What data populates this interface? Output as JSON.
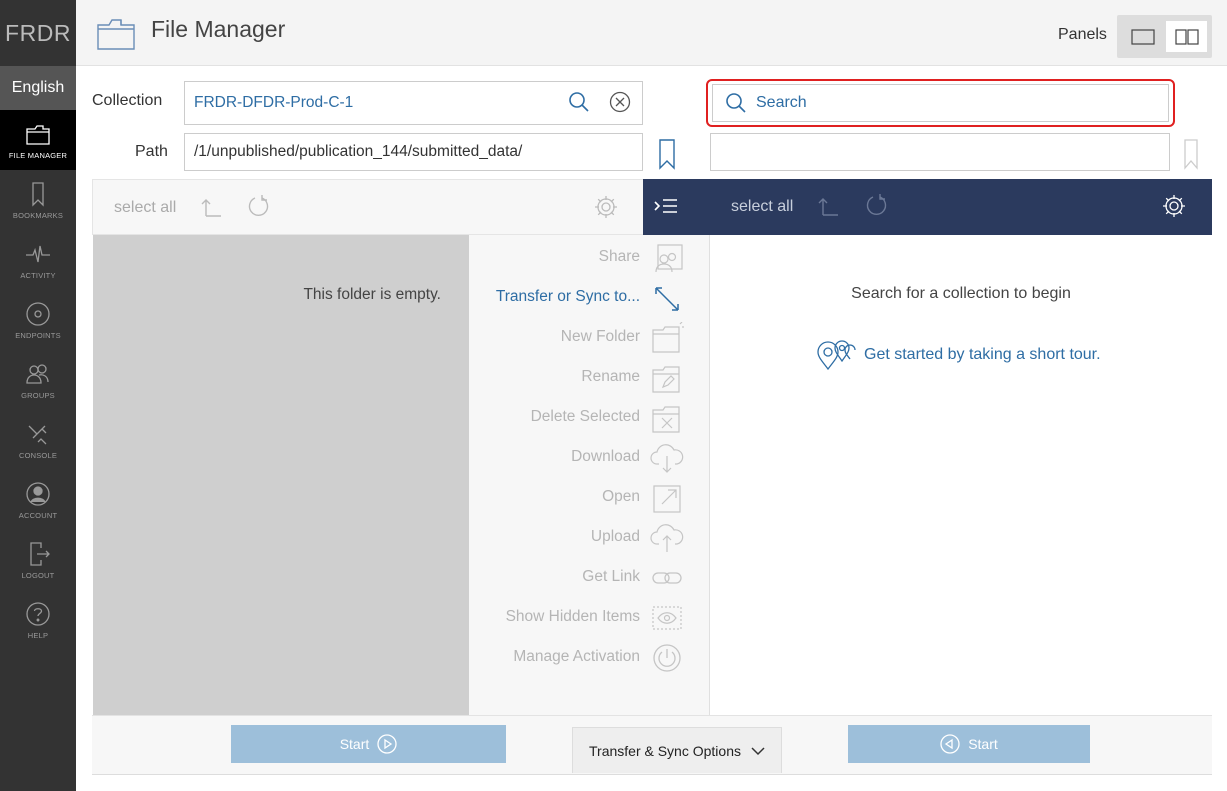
{
  "sidebar": {
    "brand": "FRDR",
    "language": "English",
    "items": [
      {
        "label": "FILE MANAGER",
        "icon": "folder-icon",
        "active": true
      },
      {
        "label": "BOOKMARKS",
        "icon": "bookmark-icon"
      },
      {
        "label": "ACTIVITY",
        "icon": "activity-icon"
      },
      {
        "label": "ENDPOINTS",
        "icon": "endpoints-icon"
      },
      {
        "label": "GROUPS",
        "icon": "groups-icon"
      },
      {
        "label": "CONSOLE",
        "icon": "console-icon"
      },
      {
        "label": "ACCOUNT",
        "icon": "account-icon"
      },
      {
        "label": "LOGOUT",
        "icon": "logout-icon"
      },
      {
        "label": "HELP",
        "icon": "help-icon"
      }
    ]
  },
  "header": {
    "title": "File Manager",
    "panels_label": "Panels"
  },
  "left": {
    "collection_label": "Collection",
    "collection_value": "FRDR-DFDR-Prod-C-1",
    "path_label": "Path",
    "path_value": "/1/unpublished/publication_144/submitted_data/",
    "select_all": "select all",
    "empty_message": "This folder is empty."
  },
  "right": {
    "search_placeholder": "Search",
    "path_value": "",
    "select_all": "select all",
    "prompt": "Search for a collection to begin",
    "tour_link": "Get started by taking a short tour."
  },
  "actions": [
    {
      "label": "Share",
      "icon": "share-icon",
      "enabled": false
    },
    {
      "label": "Transfer or Sync to...",
      "icon": "transfer-icon",
      "enabled": true
    },
    {
      "label": "New Folder",
      "icon": "new-folder-icon",
      "enabled": false
    },
    {
      "label": "Rename",
      "icon": "rename-icon",
      "enabled": false
    },
    {
      "label": "Delete Selected",
      "icon": "delete-icon",
      "enabled": false
    },
    {
      "label": "Download",
      "icon": "download-icon",
      "enabled": false
    },
    {
      "label": "Open",
      "icon": "open-icon",
      "enabled": false
    },
    {
      "label": "Upload",
      "icon": "upload-icon",
      "enabled": false
    },
    {
      "label": "Get Link",
      "icon": "link-icon",
      "enabled": false
    },
    {
      "label": "Show Hidden Items",
      "icon": "eye-icon",
      "enabled": false
    },
    {
      "label": "Manage Activation",
      "icon": "power-icon",
      "enabled": false
    }
  ],
  "bottom": {
    "start_left": "Start",
    "start_right": "Start",
    "options_label": "Transfer & Sync Options"
  },
  "colors": {
    "sidebar_bg": "#333333",
    "accent_blue": "#2e6da4",
    "right_toolbar": "#2b3a5e",
    "start_button": "#9dbfda",
    "search_highlight": "#e02020"
  }
}
